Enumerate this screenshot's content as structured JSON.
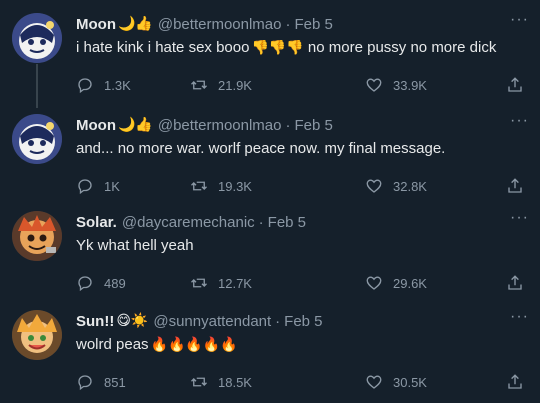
{
  "tweets": [
    {
      "name": "Moon",
      "name_emoji": "🌙👍",
      "handle": "@bettermoonlmao",
      "date": "Feb 5",
      "text_before": "i hate kink i hate sex booo",
      "text_emoji": "👎👎👎",
      "text_after": " no more pussy no more dick",
      "replies": "1.3K",
      "retweets": "21.9K",
      "likes": "33.9K"
    },
    {
      "name": "Moon",
      "name_emoji": "🌙👍",
      "handle": "@bettermoonlmao",
      "date": "Feb 5",
      "text_before": "and... no more war. worlf peace now. my final message.",
      "text_emoji": "",
      "text_after": "",
      "replies": "1K",
      "retweets": "19.3K",
      "likes": "32.8K"
    },
    {
      "name": "Solar.",
      "name_emoji": "",
      "handle": "@daycaremechanic",
      "date": "Feb 5",
      "text_before": "Yk what hell yeah",
      "text_emoji": "",
      "text_after": "",
      "replies": "489",
      "retweets": "12.7K",
      "likes": "29.6K"
    },
    {
      "name": "Sun!!",
      "name_emoji": "😋☀️",
      "handle": "@sunnyattendant",
      "date": "Feb 5",
      "text_before": "wolrd peas",
      "text_emoji": "🔥🔥🔥🔥🔥",
      "text_after": "",
      "replies": "851",
      "retweets": "18.5K",
      "likes": "30.5K"
    }
  ],
  "more_glyph": "···",
  "icons": [
    "reply-icon",
    "retweet-icon",
    "like-icon",
    "share-icon",
    "more-icon"
  ],
  "colors": {
    "background": "#15202b",
    "text": "#e7e9ea",
    "muted": "#8b98a5",
    "thread_line": "#38444d"
  }
}
